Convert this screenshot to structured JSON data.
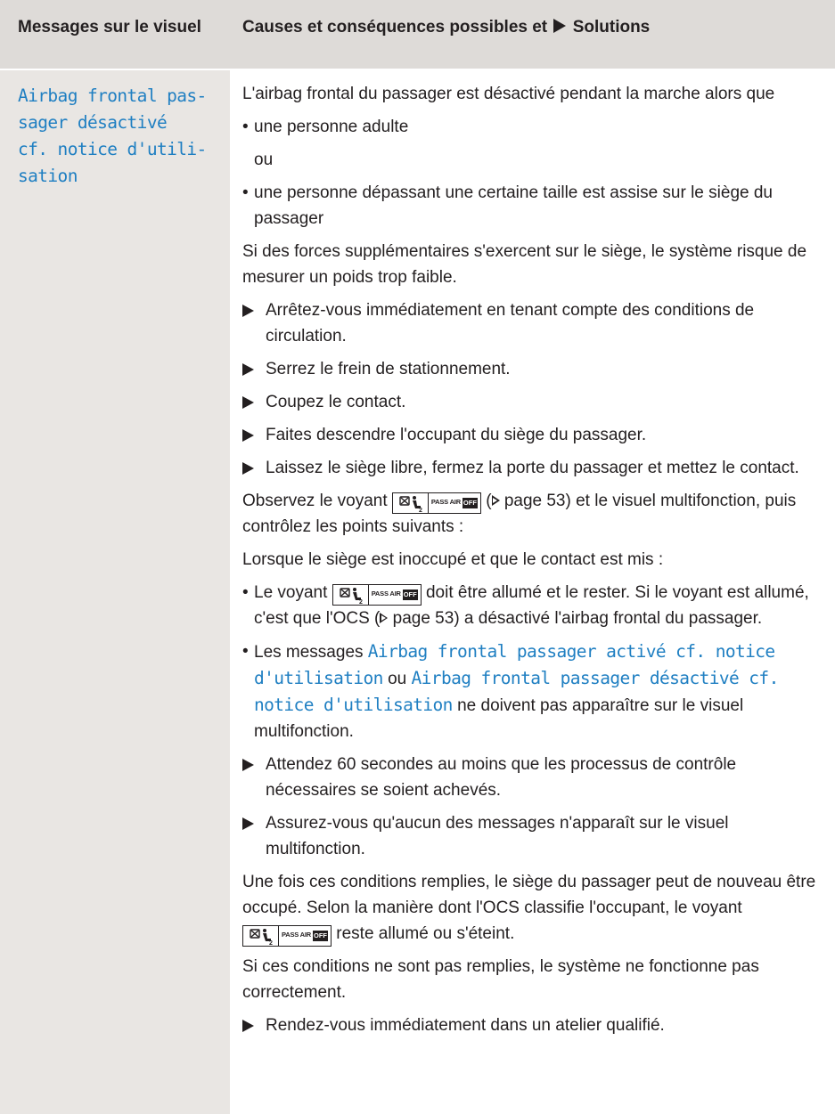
{
  "header": {
    "col1": "Messages sur le visuel",
    "col2_before": "Causes et conséquences possibles et",
    "col2_after": "Solutions"
  },
  "message": {
    "lines": [
      "Airbag frontal pas-",
      "sager désactivé",
      "cf. notice d'utili-",
      "sation"
    ]
  },
  "content": {
    "intro": "L'airbag frontal du passager est désactivé pendant la marche alors que",
    "bullet1": "une personne adulte",
    "or": "ou",
    "bullet2": "une personne dépassant une certaine taille est assise sur le siège du passager",
    "forces": "Si des forces supplémentaires s'exercent sur le siège, le système risque de mesurer un poids trop faible.",
    "steps1": [
      "Arrêtez-vous immédiatement en tenant compte des conditions de circulation.",
      "Serrez le frein de stationnement.",
      "Coupez le contact.",
      "Faites descendre l'occupant du siège du passager.",
      "Laissez le siège libre, fermez la porte du passager et mettez le contact."
    ],
    "observe_a": "Observez le voyant",
    "page_ref_a": "page 53",
    "observe_b": ") et le visuel multifonction, puis contrôlez les points suivants :",
    "when_empty": "Lorsque le siège est inoccupé et que le contact est mis :",
    "check1_a": "Le voyant",
    "check1_b": "doit être allumé et le rester. Si le voyant est allumé, c'est que l'OCS (",
    "page_ref_b": "page 53",
    "check1_c": ") a désactivé l'airbag frontal du passager.",
    "check2_a": "Les messages",
    "check2_msg1": "Airbag frontal passager activé cf. notice d'utilisation",
    "check2_or": "ou",
    "check2_msg2": "Airbag frontal passager désactivé cf. notice d'utilisation",
    "check2_b": "ne doivent pas apparaître sur le visuel multifonction.",
    "steps2": [
      "Attendez 60 secondes au moins que les processus de contrôle nécessaires se soient achevés.",
      "Assurez-vous qu'aucun des messages n'apparaît sur le visuel multifonction."
    ],
    "fulfilled_a": "Une fois ces conditions remplies, le siège du passager peut de nouveau être occupé. Selon la manière dont l'OCS classifie l'occupant, le voyant",
    "fulfilled_b": "reste allumé ou s'éteint.",
    "not_fulfilled": "Si ces conditions ne sont pas remplies, le système ne fonctionne pas correctement.",
    "final_step": "Rendez-vous immédiatement dans un atelier qualifié."
  },
  "indicator": {
    "label": "PASS AIR BAG",
    "off": "OFF",
    "seat_icon": "seat-occupant-airbag-off-icon"
  }
}
